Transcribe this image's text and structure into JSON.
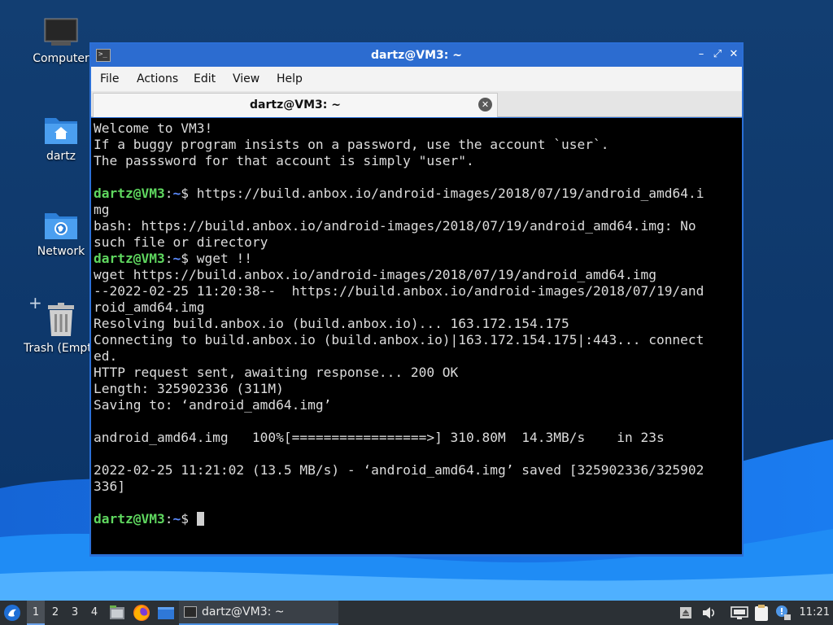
{
  "desktop": {
    "icons": [
      {
        "label": "Computer",
        "icon": "computer-icon"
      },
      {
        "label": "dartz",
        "icon": "home-folder-icon"
      },
      {
        "label": "Network",
        "icon": "network-folder-icon"
      },
      {
        "label": "Trash (Empty)",
        "icon": "trash-icon"
      }
    ]
  },
  "window": {
    "title": "dartz@VM3: ~",
    "controls": {
      "minimize": "–",
      "maximize": "⤢",
      "close": "✕"
    },
    "menu": [
      "File",
      "Actions",
      "Edit",
      "View",
      "Help"
    ],
    "tab": {
      "label": "dartz@VM3: ~",
      "close": "✕"
    }
  },
  "terminal": {
    "prompt_user": "dartz@VM3",
    "prompt_sep": ":",
    "prompt_path": "~",
    "prompt_symbol": "$ ",
    "lines": [
      "Welcome to VM3!",
      "If a buggy program insists on a password, use the account `user`.",
      "The passsword for that account is simply \"user\".",
      "",
      "$$PROMPT$$https://build.anbox.io/android-images/2018/07/19/android_amd64.i",
      "mg",
      "bash: https://build.anbox.io/android-images/2018/07/19/android_amd64.img: No",
      "such file or directory",
      "$$PROMPT$$wget !!",
      "wget https://build.anbox.io/android-images/2018/07/19/android_amd64.img",
      "--2022-02-25 11:20:38--  https://build.anbox.io/android-images/2018/07/19/and",
      "roid_amd64.img",
      "Resolving build.anbox.io (build.anbox.io)... 163.172.154.175",
      "Connecting to build.anbox.io (build.anbox.io)|163.172.154.175|:443... connect",
      "ed.",
      "HTTP request sent, awaiting response... 200 OK",
      "Length: 325902336 (311M)",
      "Saving to: ‘android_amd64.img’",
      "",
      "android_amd64.img   100%[=================>] 310.80M  14.3MB/s    in 23s",
      "",
      "2022-02-25 11:21:02 (13.5 MB/s) - ‘android_amd64.img’ saved [325902336/325902",
      "336]",
      "",
      "$$PROMPT$$"
    ]
  },
  "taskbar": {
    "menu_icon": "app-menu-icon",
    "workspaces": [
      "1",
      "2",
      "3",
      "4"
    ],
    "active_workspace": "1",
    "launchers": [
      "file-manager-icon",
      "firefox-icon",
      "show-desktop-icon"
    ],
    "task_label": "dartz@VM3: ~",
    "tray": [
      "eject-icon",
      "volume-icon",
      "network-icon",
      "clipboard-icon",
      "updates-icon"
    ],
    "clock": "11:21"
  },
  "colors": {
    "title_bar": "#2c6cd0",
    "prompt_user": "#5fd75f",
    "prompt_path": "#5c8cff",
    "taskbar": "#2b3035"
  }
}
